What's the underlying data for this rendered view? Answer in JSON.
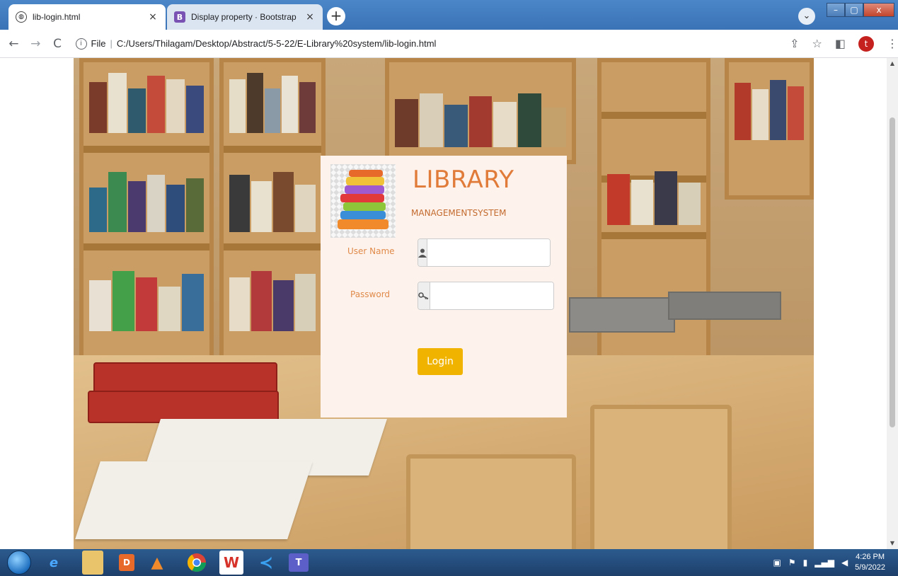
{
  "browser": {
    "tabs": [
      {
        "title": "lib-login.html",
        "favicon": "globe-icon",
        "active": true
      },
      {
        "title": "Display property · Bootstrap",
        "favicon": "B",
        "active": false
      }
    ],
    "new_tab": "+",
    "close_glyph": "×",
    "url_scheme": "File",
    "url": "C:/Users/Thilagam/Desktop/Abstract/5-5-22/E-Library%20system/lib-login.html",
    "avatar_initial": "t"
  },
  "login": {
    "title": "LIBRARY",
    "subtitle": "MANAGEMENTSYSTEM",
    "username_label": "User Name",
    "password_label": "Password",
    "username_value": "",
    "password_value": "",
    "button_label": "Login"
  },
  "taskbar": {
    "time": "4:26 PM",
    "date": "5/9/2022"
  },
  "colors": {
    "brand_orange": "#e07b39",
    "button_yellow": "#f0b400",
    "card_bg": "#fdf3ec"
  }
}
